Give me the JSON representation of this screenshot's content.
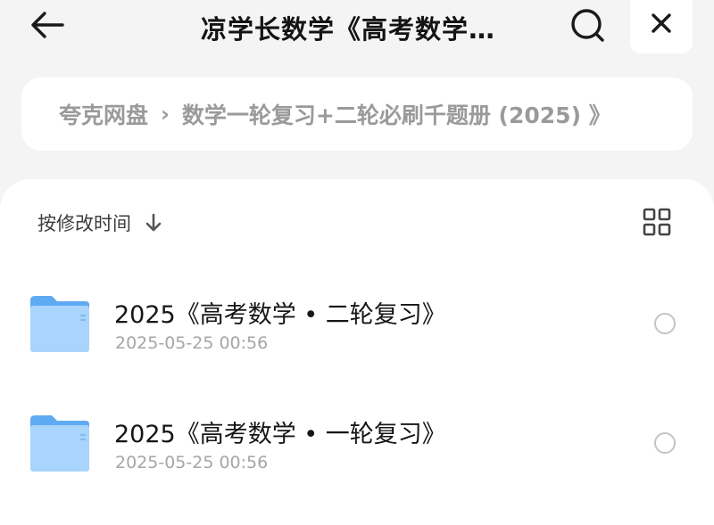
{
  "header": {
    "title": "凉学长数学《高考数学…",
    "back_icon": "arrow-left-icon",
    "search_icon": "search-icon",
    "close_icon": "close-icon"
  },
  "breadcrumb": {
    "root": "夸克网盘",
    "separator": "›",
    "current": "数学一轮复习+二轮必刷千题册 (2025) 》"
  },
  "toolbar": {
    "sort_label": "按修改时间",
    "sort_icon": "arrow-down-icon",
    "view_icon": "grid-view-icon"
  },
  "files": [
    {
      "name": "2025《高考数学 • 二轮复习》",
      "date": "2025-05-25 00:56",
      "icon": "folder-icon"
    },
    {
      "name": "2025《高考数学 • 一轮复习》",
      "date": "2025-05-25 00:56",
      "icon": "folder-icon"
    }
  ],
  "colors": {
    "background": "#f4f4f5",
    "folder_light": "#a9d4fb",
    "folder_dark": "#5faaf2",
    "muted_text": "#9a9a9a"
  }
}
